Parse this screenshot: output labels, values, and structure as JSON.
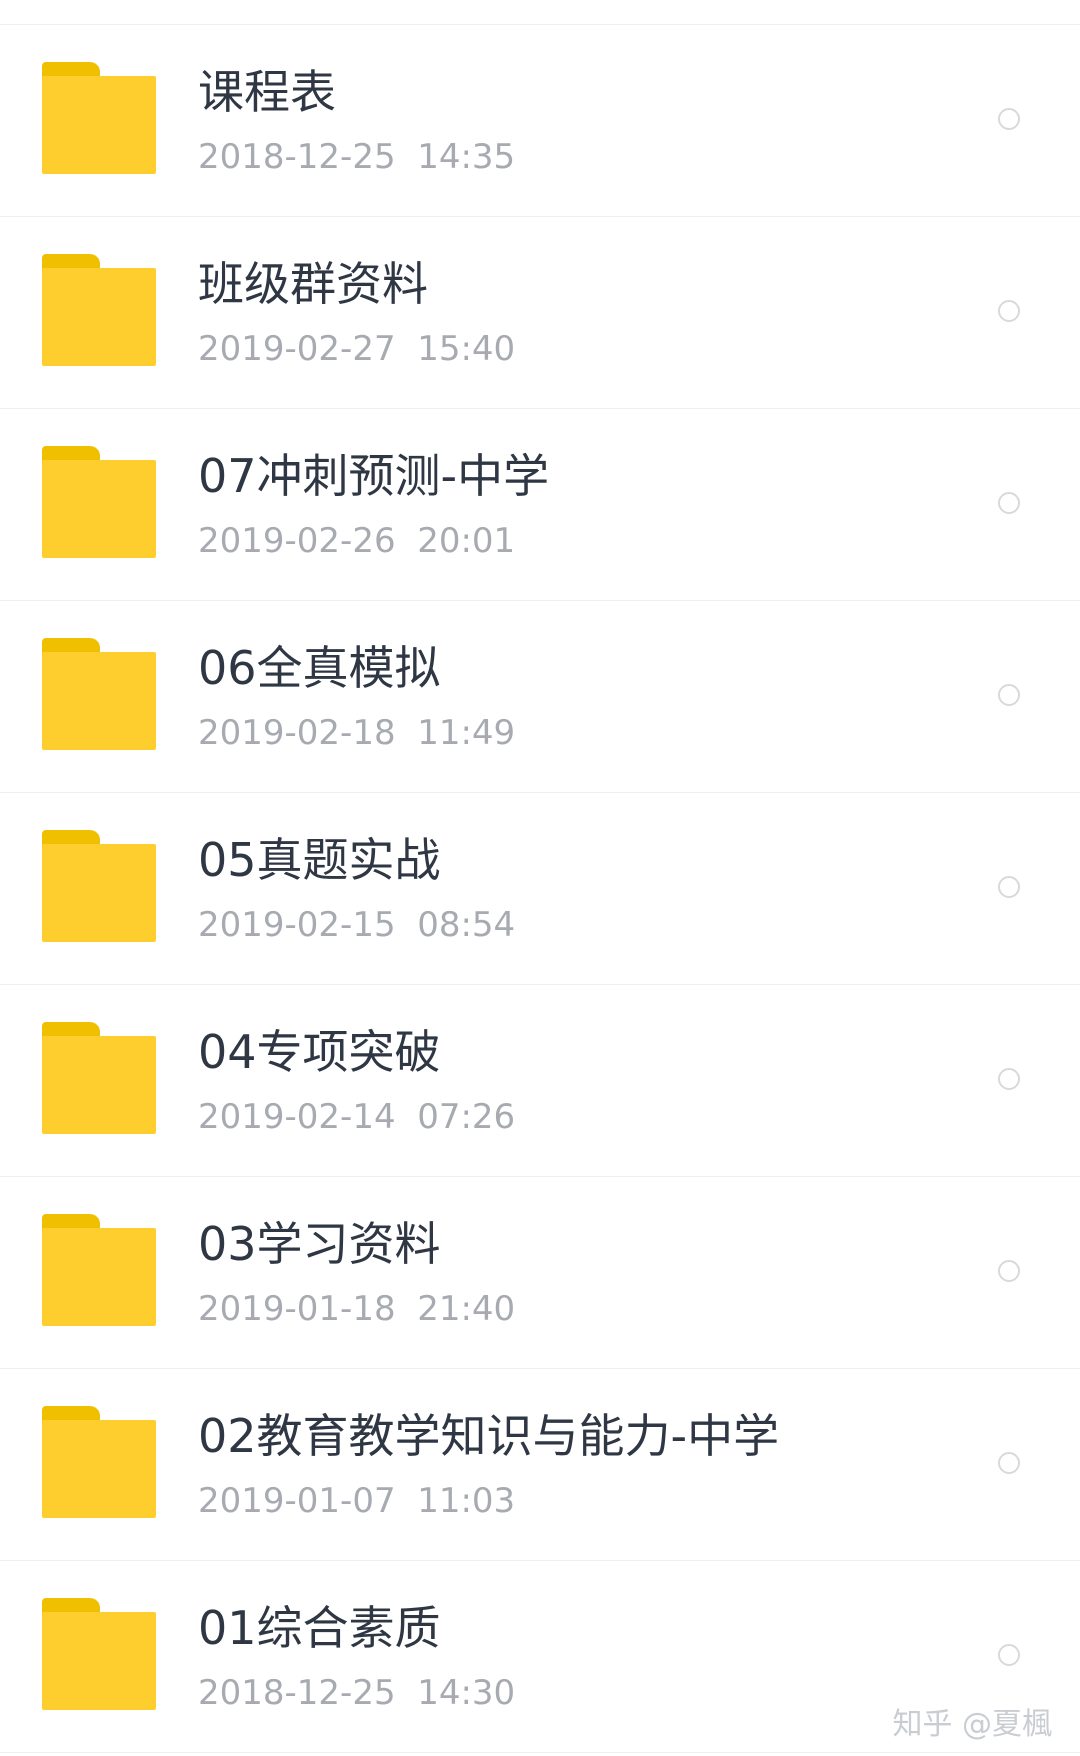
{
  "colors": {
    "folder_body": "#fece2f",
    "folder_tab": "#f0bf00",
    "title_text": "#2f3744",
    "date_text": "#a7abb1",
    "divider": "#eeeeee"
  },
  "folders": [
    {
      "name": "课程表",
      "date": "2018-12-25  14:35",
      "icon": "folder-icon",
      "selected": false
    },
    {
      "name": "班级群资料",
      "date": "2019-02-27  15:40",
      "icon": "folder-icon",
      "selected": false
    },
    {
      "name": "07冲刺预测-中学",
      "date": "2019-02-26  20:01",
      "icon": "folder-icon",
      "selected": false
    },
    {
      "name": "06全真模拟",
      "date": "2019-02-18  11:49",
      "icon": "folder-icon",
      "selected": false
    },
    {
      "name": "05真题实战",
      "date": "2019-02-15  08:54",
      "icon": "folder-icon",
      "selected": false
    },
    {
      "name": "04专项突破",
      "date": "2019-02-14  07:26",
      "icon": "folder-icon",
      "selected": false
    },
    {
      "name": "03学习资料",
      "date": "2019-01-18  21:40",
      "icon": "folder-icon",
      "selected": false
    },
    {
      "name": "02教育教学知识与能力-中学",
      "date": "2019-01-07  11:03",
      "icon": "folder-icon",
      "selected": false
    },
    {
      "name": "01综合素质",
      "date": "2018-12-25  14:30",
      "icon": "folder-icon",
      "selected": false
    }
  ],
  "watermark": "知乎 @夏楓"
}
